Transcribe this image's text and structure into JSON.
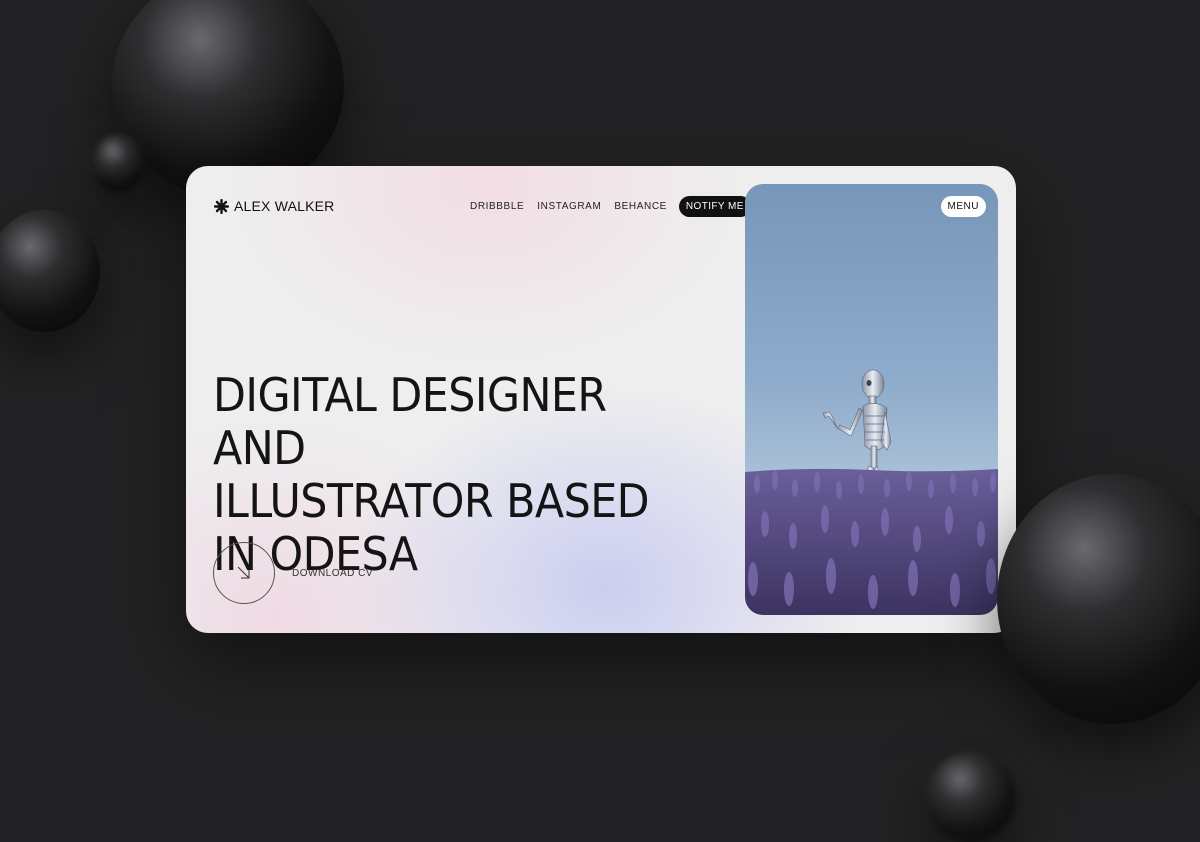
{
  "brand": {
    "name": "ALEX WALKER",
    "logo_icon": "starburst-icon"
  },
  "nav": {
    "links": [
      "DRIBBBLE",
      "INSTAGRAM",
      "BEHANCE"
    ],
    "notify_label": "NOTIFY ME"
  },
  "hero": {
    "headline_lines": [
      "DIGITAL DESIGNER AND",
      "ILLUSTRATOR BASED",
      "IN ODESA"
    ],
    "cta_label": "DOWNLOAD CV",
    "cta_icon": "arrow-down-right-icon"
  },
  "photo": {
    "menu_label": "MENU",
    "image_subject": "skeleton in lavender field"
  },
  "colors": {
    "background": "#232325",
    "card": "#eeeeef",
    "accent_dark": "#111111",
    "sky": "#8eabcb",
    "lavender": "#5a4e8a"
  }
}
